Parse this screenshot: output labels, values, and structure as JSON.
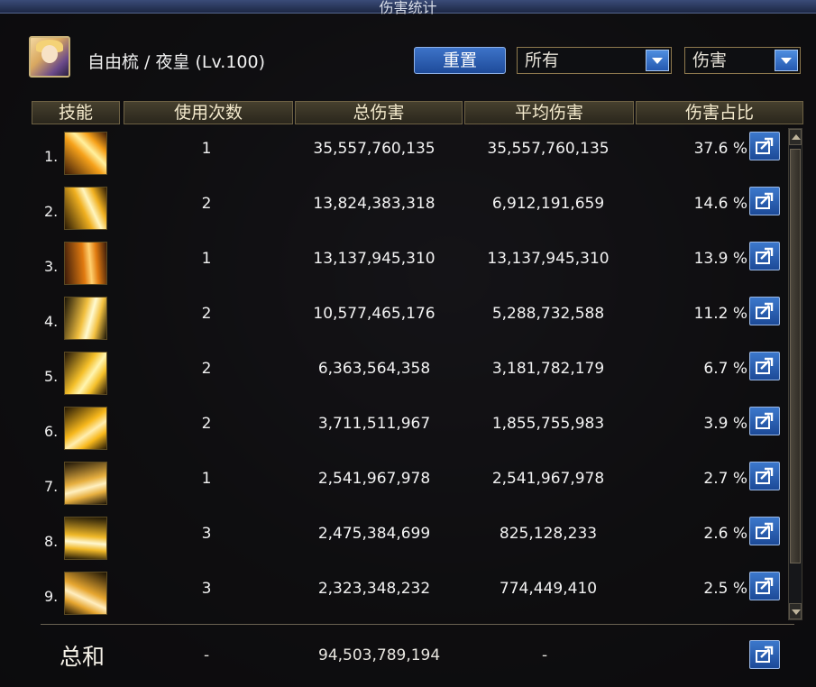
{
  "window": {
    "title": "伤害统计"
  },
  "character": {
    "name": "自由梳 / 夜皇 (Lv.100)"
  },
  "controls": {
    "reset_label": "重置",
    "filter_value": "所有",
    "type_value": "伤害"
  },
  "table": {
    "headers": [
      "技能",
      "使用次数",
      "总伤害",
      "平均伤害",
      "伤害占比"
    ],
    "rows": [
      {
        "index": "1.",
        "count": "1",
        "total": "35,557,760,135",
        "avg": "35,557,760,135",
        "pct": "37.6 %"
      },
      {
        "index": "2.",
        "count": "2",
        "total": "13,824,383,318",
        "avg": "6,912,191,659",
        "pct": "14.6 %"
      },
      {
        "index": "3.",
        "count": "1",
        "total": "13,137,945,310",
        "avg": "13,137,945,310",
        "pct": "13.9 %"
      },
      {
        "index": "4.",
        "count": "2",
        "total": "10,577,465,176",
        "avg": "5,288,732,588",
        "pct": "11.2 %"
      },
      {
        "index": "5.",
        "count": "2",
        "total": "6,363,564,358",
        "avg": "3,181,782,179",
        "pct": "6.7 %"
      },
      {
        "index": "6.",
        "count": "2",
        "total": "3,711,511,967",
        "avg": "1,855,755,983",
        "pct": "3.9 %"
      },
      {
        "index": "7.",
        "count": "1",
        "total": "2,541,967,978",
        "avg": "2,541,967,978",
        "pct": "2.7 %"
      },
      {
        "index": "8.",
        "count": "3",
        "total": "2,475,384,699",
        "avg": "825,128,233",
        "pct": "2.6 %"
      },
      {
        "index": "9.",
        "count": "3",
        "total": "2,323,348,232",
        "avg": "774,449,410",
        "pct": "2.5 %"
      }
    ]
  },
  "totals": {
    "label": "总和",
    "count": "-",
    "total": "94,503,789,194",
    "avg": "-"
  },
  "icons": {
    "export": "export-share-icon",
    "dropdown": "chevron-down-icon"
  },
  "colors": {
    "accent_blue": "#2a5fb8",
    "header_gold": "#46402e",
    "text": "#f2f2f2"
  }
}
